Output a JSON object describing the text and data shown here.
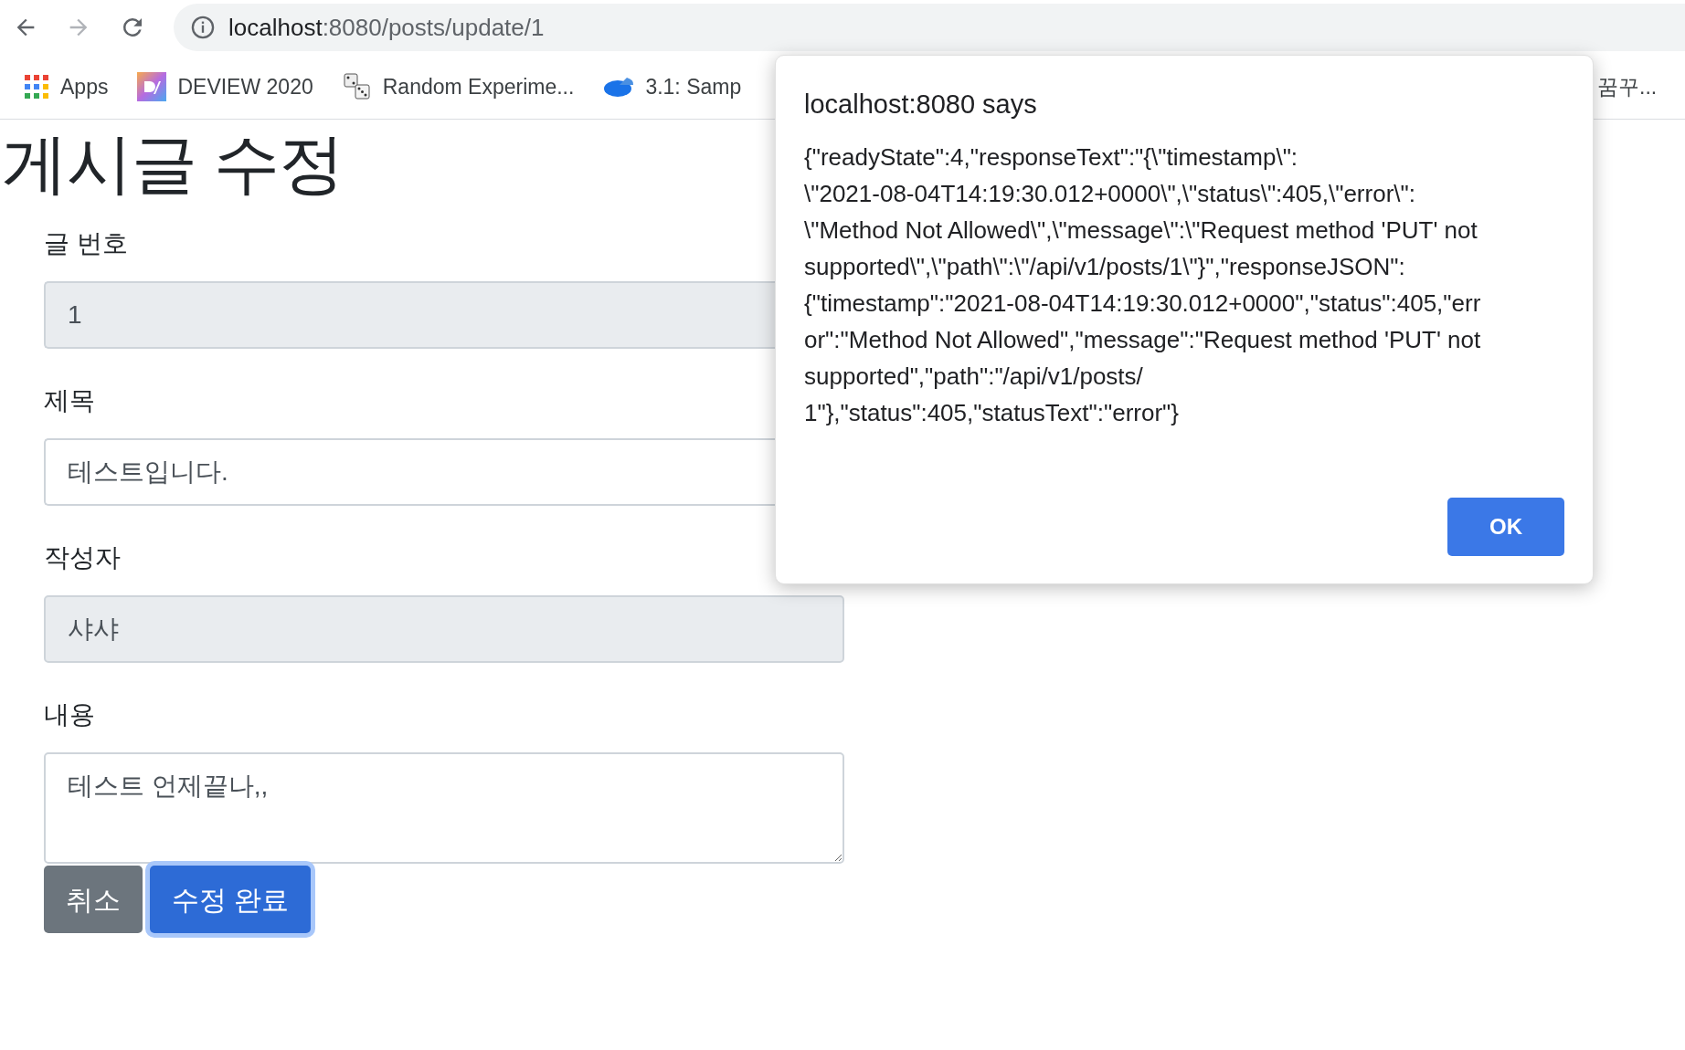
{
  "browser": {
    "url_host": "localhost",
    "url_path": ":8080/posts/update/1",
    "bookmarks": [
      {
        "label": "Apps",
        "kind": "apps"
      },
      {
        "label": "DEVIEW 2020",
        "kind": "deview"
      },
      {
        "label": "Random Experime...",
        "kind": "dice"
      },
      {
        "label": "3.1: Samp",
        "kind": "pie"
      },
      {
        "label": "꿈꾸...",
        "kind": "plain"
      }
    ]
  },
  "page": {
    "heading": "게시글 수정",
    "fields": [
      {
        "label": "글 번호",
        "value": "1",
        "readonly": true,
        "kind": "input"
      },
      {
        "label": "제목",
        "value": "테스트입니다.",
        "readonly": false,
        "kind": "input"
      },
      {
        "label": "작성자",
        "value": "샤샤",
        "readonly": true,
        "kind": "input"
      },
      {
        "label": "내용",
        "value": "테스트 언제끝나,,",
        "readonly": false,
        "kind": "textarea"
      }
    ],
    "buttons": [
      {
        "label": "취소",
        "kind": "secondary",
        "focused": false
      },
      {
        "label": "수정 완료",
        "kind": "primary",
        "focused": true
      }
    ]
  },
  "dialog": {
    "title": "localhost:8080 says",
    "message_lines": [
      "{\"readyState\":4,\"responseText\":\"{\\\"timestamp\\\":",
      "\\\"2021-08-04T14:19:30.012+0000\\\",\\\"status\\\":405,\\\"error\\\":",
      "\\\"Method Not Allowed\\\",\\\"message\\\":\\\"Request method 'PUT' not",
      "supported\\\",\\\"path\\\":\\\"/api/v1/posts/1\\\"}\",\"responseJSON\":",
      "{\"timestamp\":\"2021-08-04T14:19:30.012+0000\",\"status\":405,\"err",
      "or\":\"Method Not Allowed\",\"message\":\"Request method 'PUT' not",
      "supported\",\"path\":\"/api/v1/posts/",
      "1\"},\"status\":405,\"statusText\":\"error\"}"
    ],
    "button": "OK"
  }
}
